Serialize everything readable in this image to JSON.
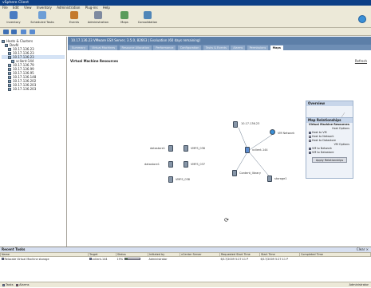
{
  "window": {
    "title": "vSphere Client",
    "host": ""
  },
  "menubar": {
    "items": [
      "File",
      "Edit",
      "View",
      "Inventory",
      "Administration",
      "Plug-ins",
      "Help"
    ]
  },
  "toolbar": {
    "buttons": [
      {
        "label": "Inventory",
        "icon": "inventory-icon",
        "color": "#4a7cc2"
      },
      {
        "label": "Scheduled Tasks",
        "icon": "scheduled-tasks-icon",
        "color": "#6d9ed6"
      },
      {
        "label": "Events",
        "icon": "events-icon",
        "color": "#c47a2c"
      },
      {
        "label": "Administration",
        "icon": "administration-icon",
        "color": "#7e8aa0"
      },
      {
        "label": "Maps",
        "icon": "maps-icon",
        "color": "#5a9b5a"
      },
      {
        "label": "Consolidation",
        "icon": "consolidation-icon",
        "color": "#4f86b8"
      }
    ]
  },
  "inventory": {
    "items": [
      "Hosts & Clusters",
      "DevN",
      "10.17.136.23",
      "10.17.136.23",
      "10.17.136.23",
      "vclient-144",
      "10.17.136.79",
      "10.17.136.99",
      "10.17.136.95",
      "10.17.136.148",
      "10.17.136.202",
      "10.17.136.203",
      "10.17.136.203"
    ],
    "selected_index": 4
  },
  "content": {
    "host_header": "10.17.136.23 VMware ESX Server, 3.5.0, 82663 | Evaluation (60 days remaining)",
    "tabs": [
      "Summary",
      "Virtual Machines",
      "Resource Allocation",
      "Performance",
      "Configuration",
      "Tasks & Events",
      "Alarms",
      "Permissions",
      "Maps"
    ],
    "active_tab": "Maps",
    "map_title": "Virtual Machine Resources",
    "refresh_label": "Refresh"
  },
  "map_nodes": [
    {
      "label": "10.17.136.23",
      "kind": "host"
    },
    {
      "label": "VM Network",
      "kind": "network"
    },
    {
      "label": "vclient-144",
      "kind": "vm-center"
    },
    {
      "label": "Content_library",
      "kind": "datastore"
    },
    {
      "label": "storage1",
      "kind": "datastore"
    },
    {
      "label": "datastore1",
      "kind": "datastore"
    },
    {
      "label": "VMFS_036",
      "kind": "datastore"
    },
    {
      "label": "datastore1",
      "kind": "datastore"
    },
    {
      "label": "VMFS_037",
      "kind": "datastore"
    },
    {
      "label": "VMFS_038",
      "kind": "datastore"
    }
  ],
  "overview": {
    "title": "Overview"
  },
  "map_options": {
    "title": "Map Relationships",
    "section": "Virtual Machine Resources",
    "host_options_label": "Host Options",
    "options": [
      {
        "label": "Host to VM",
        "checked": true
      },
      {
        "label": "Host to Network",
        "checked": false
      },
      {
        "label": "Host to Datastore",
        "checked": false
      }
    ],
    "vm_options_label": "VM Options",
    "vm_options": [
      {
        "label": "VM to Network",
        "checked": true
      },
      {
        "label": "VM to Datastore",
        "checked": true
      }
    ],
    "apply_label": "Apply Relationships"
  },
  "recent_tasks": {
    "title": "Recent Tasks",
    "close_label": "Clear ×",
    "columns": [
      "Name",
      "Target",
      "Status",
      "Initiated by",
      "vCenter Server",
      "Requested Start Time",
      "Start Time",
      "Completed Time"
    ],
    "rows": [
      {
        "name": "Relocate Virtual Machine storage",
        "target": "vclient-144",
        "status": "19%",
        "progress": 0.19,
        "initiated_by": "Administrator",
        "vcenter": "",
        "requested": "6/17/2009 5:27:11 P",
        "start": "6/17/2009 5:27:11 P",
        "completed": ""
      }
    ]
  },
  "statusbar": {
    "tasks_label": "Tasks",
    "alarms_label": "Alarms",
    "user_label": "Administrator"
  }
}
